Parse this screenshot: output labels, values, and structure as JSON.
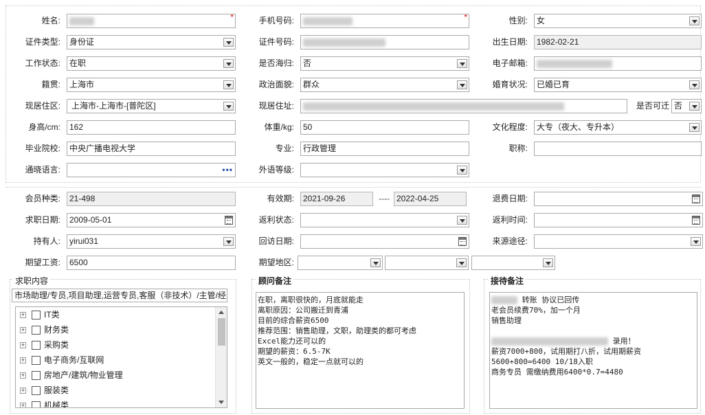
{
  "labels": {
    "name": "姓名:",
    "phone": "手机号码:",
    "gender": "性别:",
    "id_type": "证件类型:",
    "id_no": "证件号码:",
    "birth": "出生日期:",
    "work_status": "工作状态:",
    "overseas": "是否海归:",
    "email": "电子邮箱:",
    "native": "籍贯:",
    "political": "政治面貌:",
    "marital": "婚育状况:",
    "current_area": "现居住区:",
    "address": "现居住址:",
    "relocate": "是否可迁",
    "height": "身高/cm:",
    "weight": "体重/kg:",
    "education": "文化程度:",
    "school": "毕业院校:",
    "major": "专业:",
    "title": "职称:",
    "language": "通晓语言:",
    "foreign_level": "外语等级:",
    "member_type": "会员种类:",
    "validity": "有效期:",
    "refund_date": "退费日期:",
    "job_date": "求职日期:",
    "rebate_status": "返利状态:",
    "rebate_time": "返利时间:",
    "holder": "持有人:",
    "visit_date": "回访日期:",
    "source": "来源途径:",
    "salary": "期望工资:",
    "region": "期望地区:"
  },
  "values": {
    "required_mark": "*",
    "gender": "女",
    "id_type": "身份证",
    "birth": "1982-02-21",
    "work_status": "在职",
    "overseas": "否",
    "native": "上海市",
    "political": "群众",
    "marital": "已婚已育",
    "current_area": "上海市-上海市-[普陀区]",
    "relocate": "否",
    "height": "162",
    "weight": "50",
    "education": "大专（夜大、专升本）",
    "school": "中央广播电视大学",
    "major": "行政管理",
    "title": "",
    "language_dots": "•••",
    "foreign_level": "",
    "member_type": "21-498",
    "valid_from": "2021-09-26",
    "valid_sep": "----",
    "valid_to": "2022-04-25",
    "job_date": "2009-05-01",
    "holder": "yirui031",
    "salary": "6500"
  },
  "job_content": {
    "title": "求职内容",
    "summary": "市场助理/专员,项目助理,运营专员,客服（非技术）/主管/经",
    "tree": [
      "IT类",
      "财务类",
      "采购类",
      "电子商务/互联网",
      "房地产/建筑/物业管理",
      "服装类",
      "机械类"
    ]
  },
  "consultant_notes": {
    "title": "顾问备注",
    "text": "在职，离职很快的，月底就能走\n离职原因：公司搬迁到青浦\n目前的综合薪资6500\n推荐范围：销售助理，文职，助理类的都可考虑\nExcel能力还可以的\n期望的薪资：6.5-7K\n英文一般的，稳定一点就可以的"
  },
  "reception_notes": {
    "title": "接待备注",
    "line1": " 转账 协议已回传",
    "text": "老会员续费70%，加一个月\n销售助理",
    "line_recorded": " 录用！",
    "text2": "薪资7000+800，试用期打八折，试用期薪资\n5600+800=6400 10/18入职\n商务专员 需缴纳费用6400*0.7=4480"
  }
}
